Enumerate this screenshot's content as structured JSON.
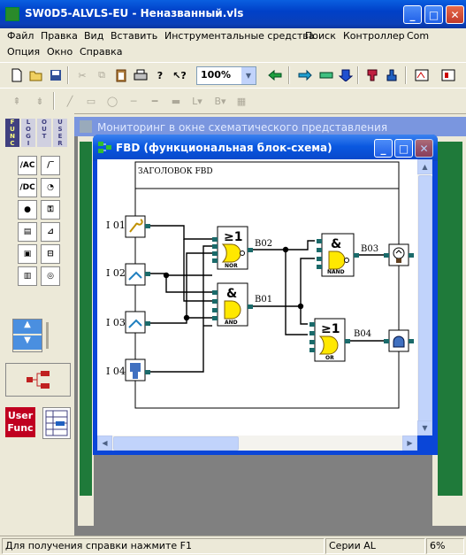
{
  "app": {
    "title": "SW0D5-ALVLS-EU - Неназванный.vls",
    "colors": {
      "titlebar": "#0a4ad6",
      "face": "#ece9d8",
      "mdi_bg": "#808080"
    }
  },
  "menu": [
    {
      "label": "Файл"
    },
    {
      "label": "Правка"
    },
    {
      "label": "Вид"
    },
    {
      "label": "Вставить"
    },
    {
      "label": "Инструментальные средства"
    },
    {
      "label": "Поиск"
    },
    {
      "label": "Контроллер"
    },
    {
      "label": "Com"
    },
    {
      "label": "Опция"
    },
    {
      "label": "Окно"
    },
    {
      "label": "Справка"
    }
  ],
  "toolbar": {
    "zoom_value": "100%",
    "icons": [
      "new-icon",
      "open-icon",
      "save-icon",
      "cut-icon",
      "copy-icon",
      "paste-icon",
      "print-icon",
      "help-icon",
      "context-help-icon",
      "zoom-dropdown",
      "back-icon",
      "transfer-icon",
      "transfer2-icon",
      "transfer3-icon",
      "read-icon",
      "write-icon",
      "monitor-icon",
      "monitor2-icon"
    ]
  },
  "toolbar2": {
    "icons": [
      "align-icon",
      "align2-icon",
      "line-icon",
      "rect-icon",
      "hline-icon",
      "hline2-icon",
      "bold-icon",
      "label-icon",
      "bold-text-icon",
      "table-icon"
    ],
    "label_l": "L",
    "label_b": "B"
  },
  "palette": {
    "mode_tabs": [
      "FUNC",
      "LOGI",
      "OUT",
      "USER"
    ],
    "user_func_label": "User\nFunc"
  },
  "bg_window": {
    "title": "Мониторинг в окне схематического представления"
  },
  "fbd_window": {
    "title": "FBD (функциональная блок-схема)",
    "header_label": "ЗАГОЛОВОК FBD",
    "inputs": [
      "I 01",
      "I 02",
      "I 03",
      "I 04"
    ],
    "blocks": [
      {
        "id": "B02",
        "symbol": "≥1",
        "type": "NOR"
      },
      {
        "id": "B01",
        "symbol": "&",
        "type": "AND"
      },
      {
        "id": "B03",
        "symbol": "&",
        "type": "NAND"
      },
      {
        "id": "B04",
        "symbol": "≥1",
        "type": "OR"
      }
    ]
  },
  "status": {
    "hint": "Для получения справки нажмите F1",
    "series": "Серии AL",
    "percent": "6%"
  }
}
